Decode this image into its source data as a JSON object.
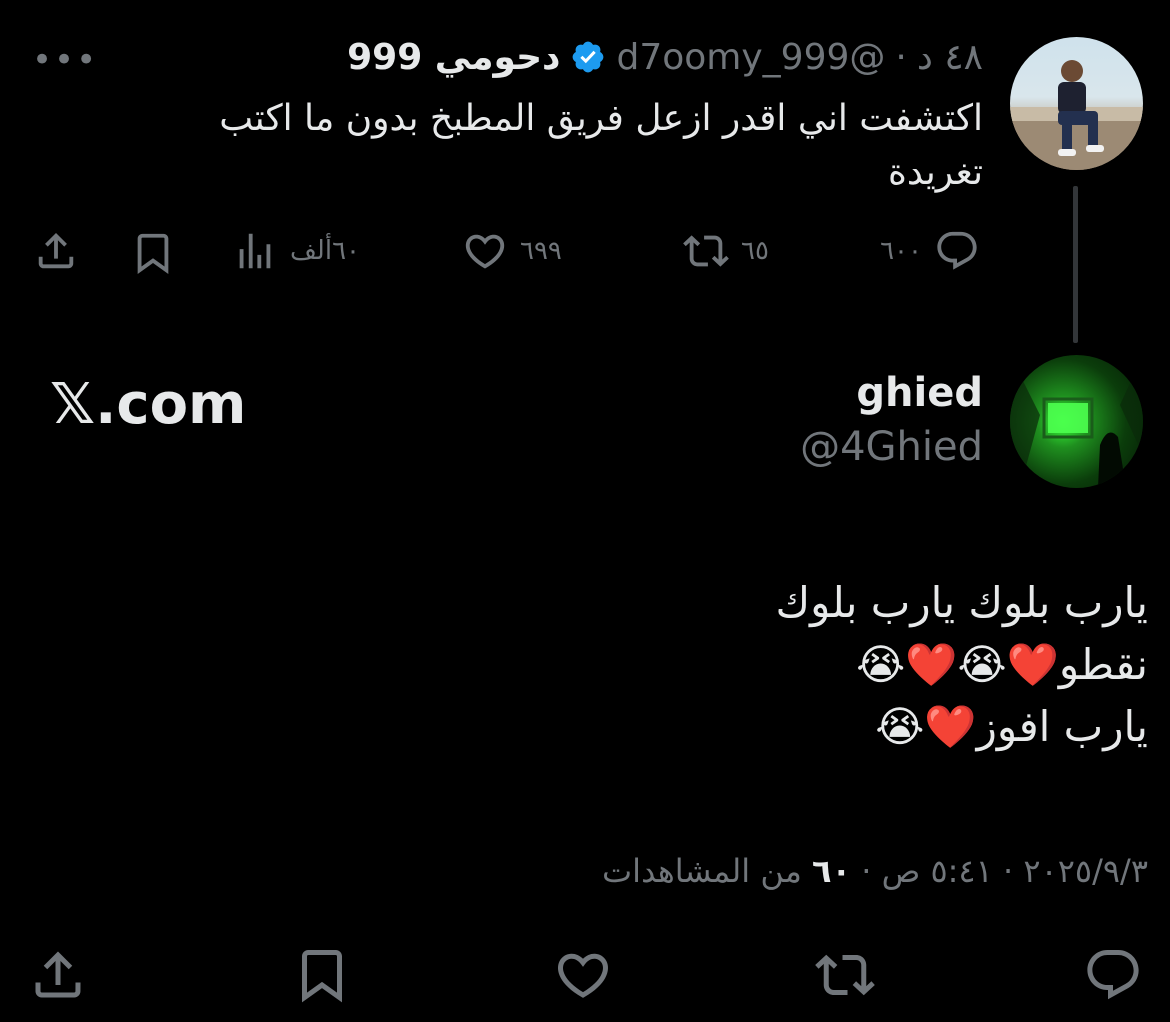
{
  "quoted_tweet": {
    "display_name": "دحومي 999",
    "handle": "@d7oomy_999",
    "time": "٤٨ د",
    "separator": "·",
    "text": "اكتشفت اني اقدر ازعل فريق المطبخ بدون ما اكتب تغريدة",
    "replies": "٦٠٠",
    "retweets": "٦٥",
    "likes": "٦٩٩",
    "views": "٦٠ألف",
    "more_icon": "more-icon",
    "verified_icon": "verified-badge-icon"
  },
  "reply_tweet": {
    "display_name": "ghied",
    "handle": "@4Ghied",
    "text_line1": "يارب بلوك يارب بلوك",
    "text_line2": "نقطو❤️😭❤️😭",
    "text_line3": "يارب افوز❤️😭",
    "date": "٢٠٢٥/٩/٣",
    "clock": "٥:٤١ ص",
    "views_count": "٦٠",
    "views_label": "من المشاهدات"
  },
  "watermark": "𝕏.com",
  "colors": {
    "background": "#000000",
    "text": "#e7e9ea",
    "muted": "#71767b",
    "verified": "#1d9bf0"
  }
}
